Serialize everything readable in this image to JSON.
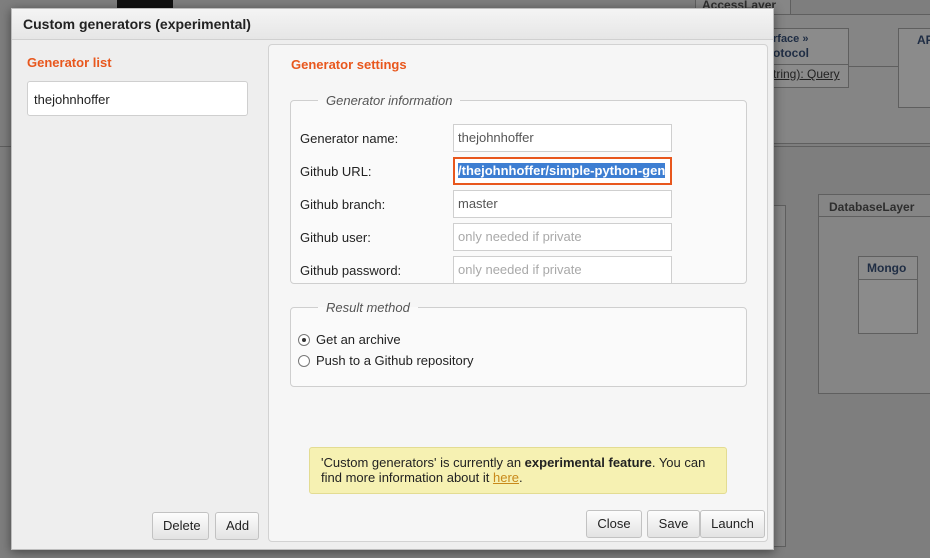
{
  "background": {
    "package_access": "AccessLayer",
    "interface_stereotype": "rface »",
    "interface_name": "otocol",
    "interface_method": "tring): Query",
    "api_label": "AP",
    "package_database": "DatabaseLayer",
    "class_mongo": "Mongo"
  },
  "dialog": {
    "title": "Custom generators (experimental)",
    "generator_list": {
      "title": "Generator list",
      "items": [
        "thejohnhoffer"
      ],
      "delete_label": "Delete",
      "add_label": "Add"
    },
    "settings": {
      "title": "Generator settings",
      "info_legend": "Generator information",
      "fields": {
        "name": {
          "label": "Generator name:",
          "value": "thejohnhoffer"
        },
        "url": {
          "label": "Github URL:",
          "value": "/thejohnhoffer/simple-python-gen"
        },
        "branch": {
          "label": "Github branch:",
          "value": "master"
        },
        "user": {
          "label": "Github user:",
          "placeholder": "only needed if private"
        },
        "password": {
          "label": "Github password:",
          "placeholder": "only needed if private"
        }
      },
      "result_legend": "Result method",
      "result_options": [
        "Get an archive",
        "Push to a Github repository"
      ],
      "result_selected": 0
    },
    "notice": {
      "part1": "'Custom generators' is currently an ",
      "bold": "experimental feature",
      "part2": ". You can find more information about it ",
      "link": "here",
      "part3": "."
    },
    "buttons": {
      "close": "Close",
      "save": "Save",
      "launch": "Launch"
    }
  }
}
